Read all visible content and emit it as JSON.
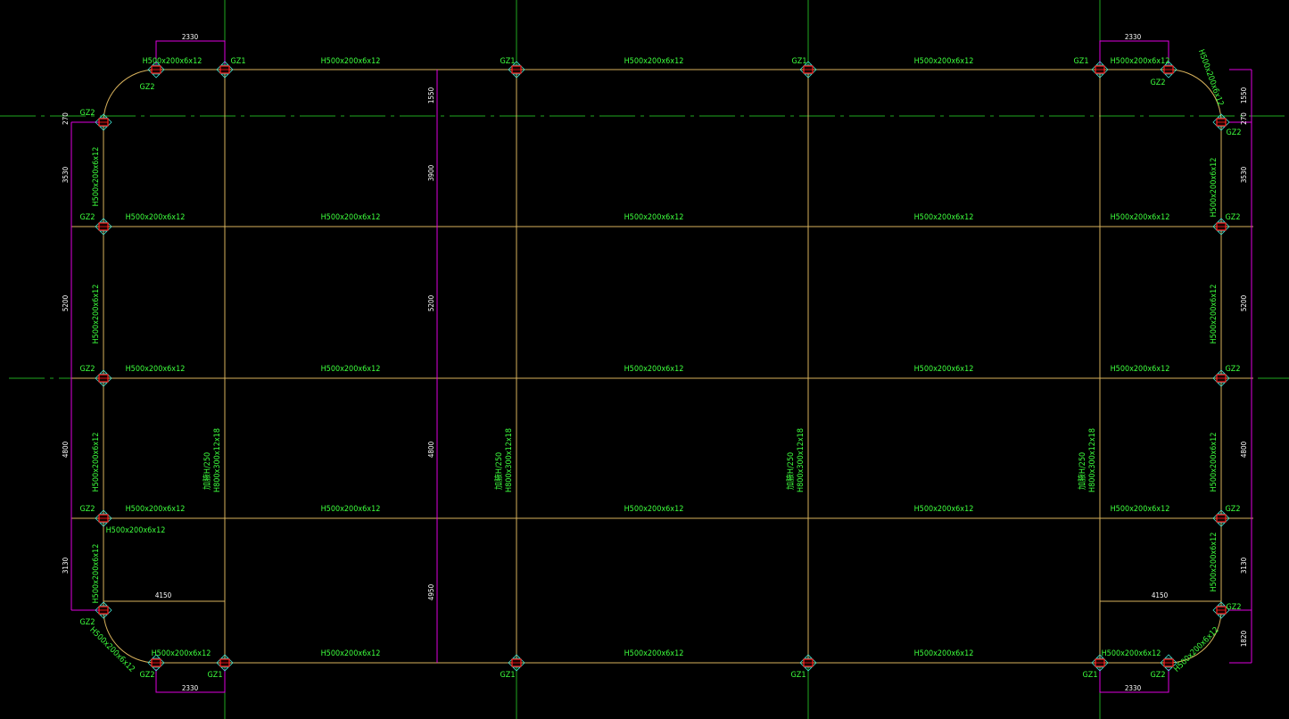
{
  "beams": {
    "secondary": "H500x200x6x12",
    "primary_lines": [
      "H800x300x12x18",
      "加腋H/250"
    ]
  },
  "columns": {
    "interior": "GZ1",
    "edge": "GZ2"
  },
  "dimensions": {
    "horizontal": [
      "2330",
      "4150"
    ],
    "left_side": [
      "270",
      "3530",
      "5200",
      "4800",
      "3130"
    ],
    "interior": [
      "1550",
      "3900",
      "5200",
      "4800",
      "4950"
    ],
    "right_side": [
      "1550",
      "270",
      "3530",
      "5200",
      "4800",
      "3130",
      "1820"
    ]
  },
  "colors": {
    "background": "#000000",
    "beam": "#d8b25c",
    "grid": "#1fa81f",
    "text": "#3dff3d",
    "dimension": "#e000e0",
    "column": "#ff2020"
  }
}
